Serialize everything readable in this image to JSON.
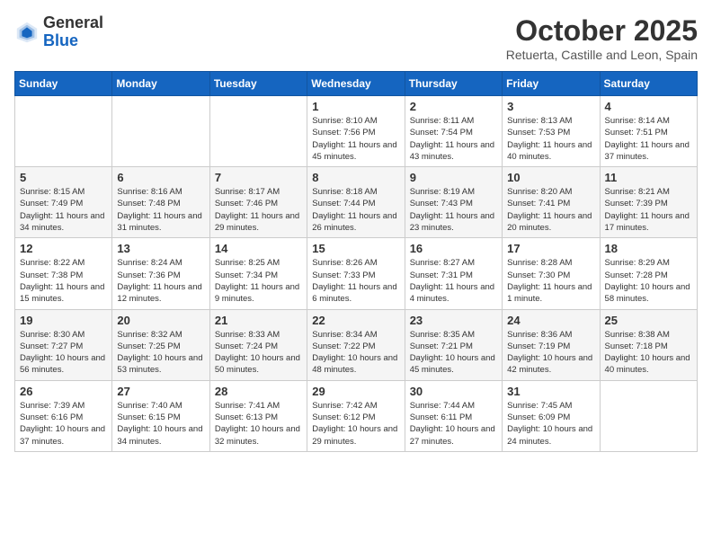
{
  "header": {
    "logo_general": "General",
    "logo_blue": "Blue",
    "month_title": "October 2025",
    "subtitle": "Retuerta, Castille and Leon, Spain"
  },
  "weekdays": [
    "Sunday",
    "Monday",
    "Tuesday",
    "Wednesday",
    "Thursday",
    "Friday",
    "Saturday"
  ],
  "weeks": [
    [
      {
        "day": "",
        "sunrise": "",
        "sunset": "",
        "daylight": ""
      },
      {
        "day": "",
        "sunrise": "",
        "sunset": "",
        "daylight": ""
      },
      {
        "day": "",
        "sunrise": "",
        "sunset": "",
        "daylight": ""
      },
      {
        "day": "1",
        "sunrise": "Sunrise: 8:10 AM",
        "sunset": "Sunset: 7:56 PM",
        "daylight": "Daylight: 11 hours and 45 minutes."
      },
      {
        "day": "2",
        "sunrise": "Sunrise: 8:11 AM",
        "sunset": "Sunset: 7:54 PM",
        "daylight": "Daylight: 11 hours and 43 minutes."
      },
      {
        "day": "3",
        "sunrise": "Sunrise: 8:13 AM",
        "sunset": "Sunset: 7:53 PM",
        "daylight": "Daylight: 11 hours and 40 minutes."
      },
      {
        "day": "4",
        "sunrise": "Sunrise: 8:14 AM",
        "sunset": "Sunset: 7:51 PM",
        "daylight": "Daylight: 11 hours and 37 minutes."
      }
    ],
    [
      {
        "day": "5",
        "sunrise": "Sunrise: 8:15 AM",
        "sunset": "Sunset: 7:49 PM",
        "daylight": "Daylight: 11 hours and 34 minutes."
      },
      {
        "day": "6",
        "sunrise": "Sunrise: 8:16 AM",
        "sunset": "Sunset: 7:48 PM",
        "daylight": "Daylight: 11 hours and 31 minutes."
      },
      {
        "day": "7",
        "sunrise": "Sunrise: 8:17 AM",
        "sunset": "Sunset: 7:46 PM",
        "daylight": "Daylight: 11 hours and 29 minutes."
      },
      {
        "day": "8",
        "sunrise": "Sunrise: 8:18 AM",
        "sunset": "Sunset: 7:44 PM",
        "daylight": "Daylight: 11 hours and 26 minutes."
      },
      {
        "day": "9",
        "sunrise": "Sunrise: 8:19 AM",
        "sunset": "Sunset: 7:43 PM",
        "daylight": "Daylight: 11 hours and 23 minutes."
      },
      {
        "day": "10",
        "sunrise": "Sunrise: 8:20 AM",
        "sunset": "Sunset: 7:41 PM",
        "daylight": "Daylight: 11 hours and 20 minutes."
      },
      {
        "day": "11",
        "sunrise": "Sunrise: 8:21 AM",
        "sunset": "Sunset: 7:39 PM",
        "daylight": "Daylight: 11 hours and 17 minutes."
      }
    ],
    [
      {
        "day": "12",
        "sunrise": "Sunrise: 8:22 AM",
        "sunset": "Sunset: 7:38 PM",
        "daylight": "Daylight: 11 hours and 15 minutes."
      },
      {
        "day": "13",
        "sunrise": "Sunrise: 8:24 AM",
        "sunset": "Sunset: 7:36 PM",
        "daylight": "Daylight: 11 hours and 12 minutes."
      },
      {
        "day": "14",
        "sunrise": "Sunrise: 8:25 AM",
        "sunset": "Sunset: 7:34 PM",
        "daylight": "Daylight: 11 hours and 9 minutes."
      },
      {
        "day": "15",
        "sunrise": "Sunrise: 8:26 AM",
        "sunset": "Sunset: 7:33 PM",
        "daylight": "Daylight: 11 hours and 6 minutes."
      },
      {
        "day": "16",
        "sunrise": "Sunrise: 8:27 AM",
        "sunset": "Sunset: 7:31 PM",
        "daylight": "Daylight: 11 hours and 4 minutes."
      },
      {
        "day": "17",
        "sunrise": "Sunrise: 8:28 AM",
        "sunset": "Sunset: 7:30 PM",
        "daylight": "Daylight: 11 hours and 1 minute."
      },
      {
        "day": "18",
        "sunrise": "Sunrise: 8:29 AM",
        "sunset": "Sunset: 7:28 PM",
        "daylight": "Daylight: 10 hours and 58 minutes."
      }
    ],
    [
      {
        "day": "19",
        "sunrise": "Sunrise: 8:30 AM",
        "sunset": "Sunset: 7:27 PM",
        "daylight": "Daylight: 10 hours and 56 minutes."
      },
      {
        "day": "20",
        "sunrise": "Sunrise: 8:32 AM",
        "sunset": "Sunset: 7:25 PM",
        "daylight": "Daylight: 10 hours and 53 minutes."
      },
      {
        "day": "21",
        "sunrise": "Sunrise: 8:33 AM",
        "sunset": "Sunset: 7:24 PM",
        "daylight": "Daylight: 10 hours and 50 minutes."
      },
      {
        "day": "22",
        "sunrise": "Sunrise: 8:34 AM",
        "sunset": "Sunset: 7:22 PM",
        "daylight": "Daylight: 10 hours and 48 minutes."
      },
      {
        "day": "23",
        "sunrise": "Sunrise: 8:35 AM",
        "sunset": "Sunset: 7:21 PM",
        "daylight": "Daylight: 10 hours and 45 minutes."
      },
      {
        "day": "24",
        "sunrise": "Sunrise: 8:36 AM",
        "sunset": "Sunset: 7:19 PM",
        "daylight": "Daylight: 10 hours and 42 minutes."
      },
      {
        "day": "25",
        "sunrise": "Sunrise: 8:38 AM",
        "sunset": "Sunset: 7:18 PM",
        "daylight": "Daylight: 10 hours and 40 minutes."
      }
    ],
    [
      {
        "day": "26",
        "sunrise": "Sunrise: 7:39 AM",
        "sunset": "Sunset: 6:16 PM",
        "daylight": "Daylight: 10 hours and 37 minutes."
      },
      {
        "day": "27",
        "sunrise": "Sunrise: 7:40 AM",
        "sunset": "Sunset: 6:15 PM",
        "daylight": "Daylight: 10 hours and 34 minutes."
      },
      {
        "day": "28",
        "sunrise": "Sunrise: 7:41 AM",
        "sunset": "Sunset: 6:13 PM",
        "daylight": "Daylight: 10 hours and 32 minutes."
      },
      {
        "day": "29",
        "sunrise": "Sunrise: 7:42 AM",
        "sunset": "Sunset: 6:12 PM",
        "daylight": "Daylight: 10 hours and 29 minutes."
      },
      {
        "day": "30",
        "sunrise": "Sunrise: 7:44 AM",
        "sunset": "Sunset: 6:11 PM",
        "daylight": "Daylight: 10 hours and 27 minutes."
      },
      {
        "day": "31",
        "sunrise": "Sunrise: 7:45 AM",
        "sunset": "Sunset: 6:09 PM",
        "daylight": "Daylight: 10 hours and 24 minutes."
      },
      {
        "day": "",
        "sunrise": "",
        "sunset": "",
        "daylight": ""
      }
    ]
  ]
}
